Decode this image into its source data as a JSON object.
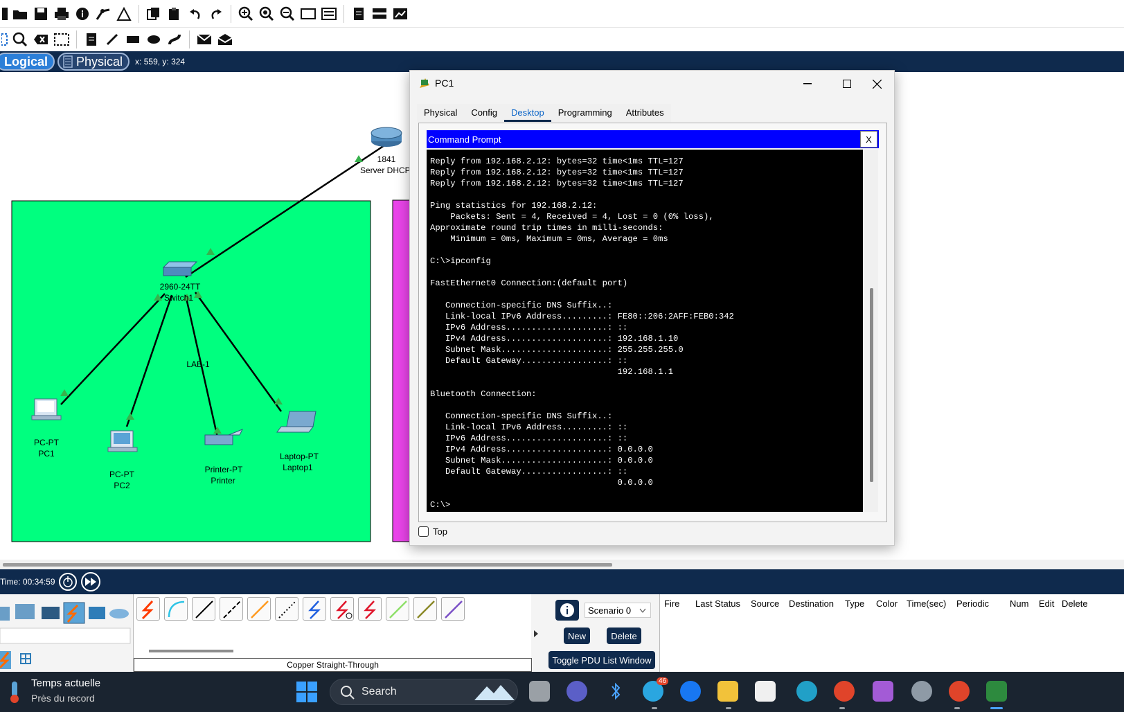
{
  "mode_bar": {
    "logical": "Logical",
    "physical": "Physical",
    "coords": "x: 559, y: 324"
  },
  "topology": {
    "router": {
      "model": "1841",
      "name": "Server DHCP"
    },
    "switch": {
      "model": "2960-24TT",
      "name": "Switch1"
    },
    "zone_label": "LAB-1",
    "devices": [
      {
        "model": "PC-PT",
        "name": "PC1"
      },
      {
        "model": "PC-PT",
        "name": "PC2"
      },
      {
        "model": "Printer-PT",
        "name": "Printer"
      },
      {
        "model": "Laptop-PT",
        "name": "Laptop1"
      }
    ],
    "colors": {
      "zone_green": "#00ff7f",
      "zone_magenta": "#ea44ea",
      "link": "#000000",
      "link_led": "#37b24d"
    }
  },
  "dialog": {
    "title": "PC1",
    "tabs": [
      "Physical",
      "Config",
      "Desktop",
      "Programming",
      "Attributes"
    ],
    "active_tab": "Desktop",
    "panel_title": "Command Prompt",
    "close_label": "X",
    "terminal_lines": [
      "Reply from 192.168.2.12: bytes=32 time<1ms TTL=127",
      "Reply from 192.168.2.12: bytes=32 time<1ms TTL=127",
      "Reply from 192.168.2.12: bytes=32 time<1ms TTL=127",
      "",
      "Ping statistics for 192.168.2.12:",
      "    Packets: Sent = 4, Received = 4, Lost = 0 (0% loss),",
      "Approximate round trip times in milli-seconds:",
      "    Minimum = 0ms, Maximum = 0ms, Average = 0ms",
      "",
      "C:\\>ipconfig",
      "",
      "FastEthernet0 Connection:(default port)",
      "",
      "   Connection-specific DNS Suffix..:",
      "   Link-local IPv6 Address.........: FE80::206:2AFF:FEB0:342",
      "   IPv6 Address....................: ::",
      "   IPv4 Address....................: 192.168.1.10",
      "   Subnet Mask.....................: 255.255.255.0",
      "   Default Gateway.................: ::",
      "                                     192.168.1.1",
      "",
      "Bluetooth Connection:",
      "",
      "   Connection-specific DNS Suffix..:",
      "   Link-local IPv6 Address.........: ::",
      "   IPv6 Address....................: ::",
      "   IPv4 Address....................: 0.0.0.0",
      "   Subnet Mask.....................: 0.0.0.0",
      "   Default Gateway.................: ::",
      "                                     0.0.0.0",
      "",
      "C:\\>"
    ],
    "top_checkbox_label": "Top"
  },
  "bottom": {
    "time_label": "Time: 00:34:59",
    "connection_label": "Copper Straight-Through",
    "scenario": "Scenario 0",
    "new_label": "New",
    "delete_label": "Delete",
    "toggle_label": "Toggle PDU List Window",
    "pdu_columns": [
      "Fire",
      "Last Status",
      "Source",
      "Destination",
      "Type",
      "Color",
      "Time(sec)",
      "Periodic",
      "Num",
      "Edit",
      "Delete"
    ]
  },
  "taskbar": {
    "weather_title": "Temps actuelle",
    "weather_sub": "Près du record",
    "search_label": "Search",
    "telegram_badge": "46"
  }
}
